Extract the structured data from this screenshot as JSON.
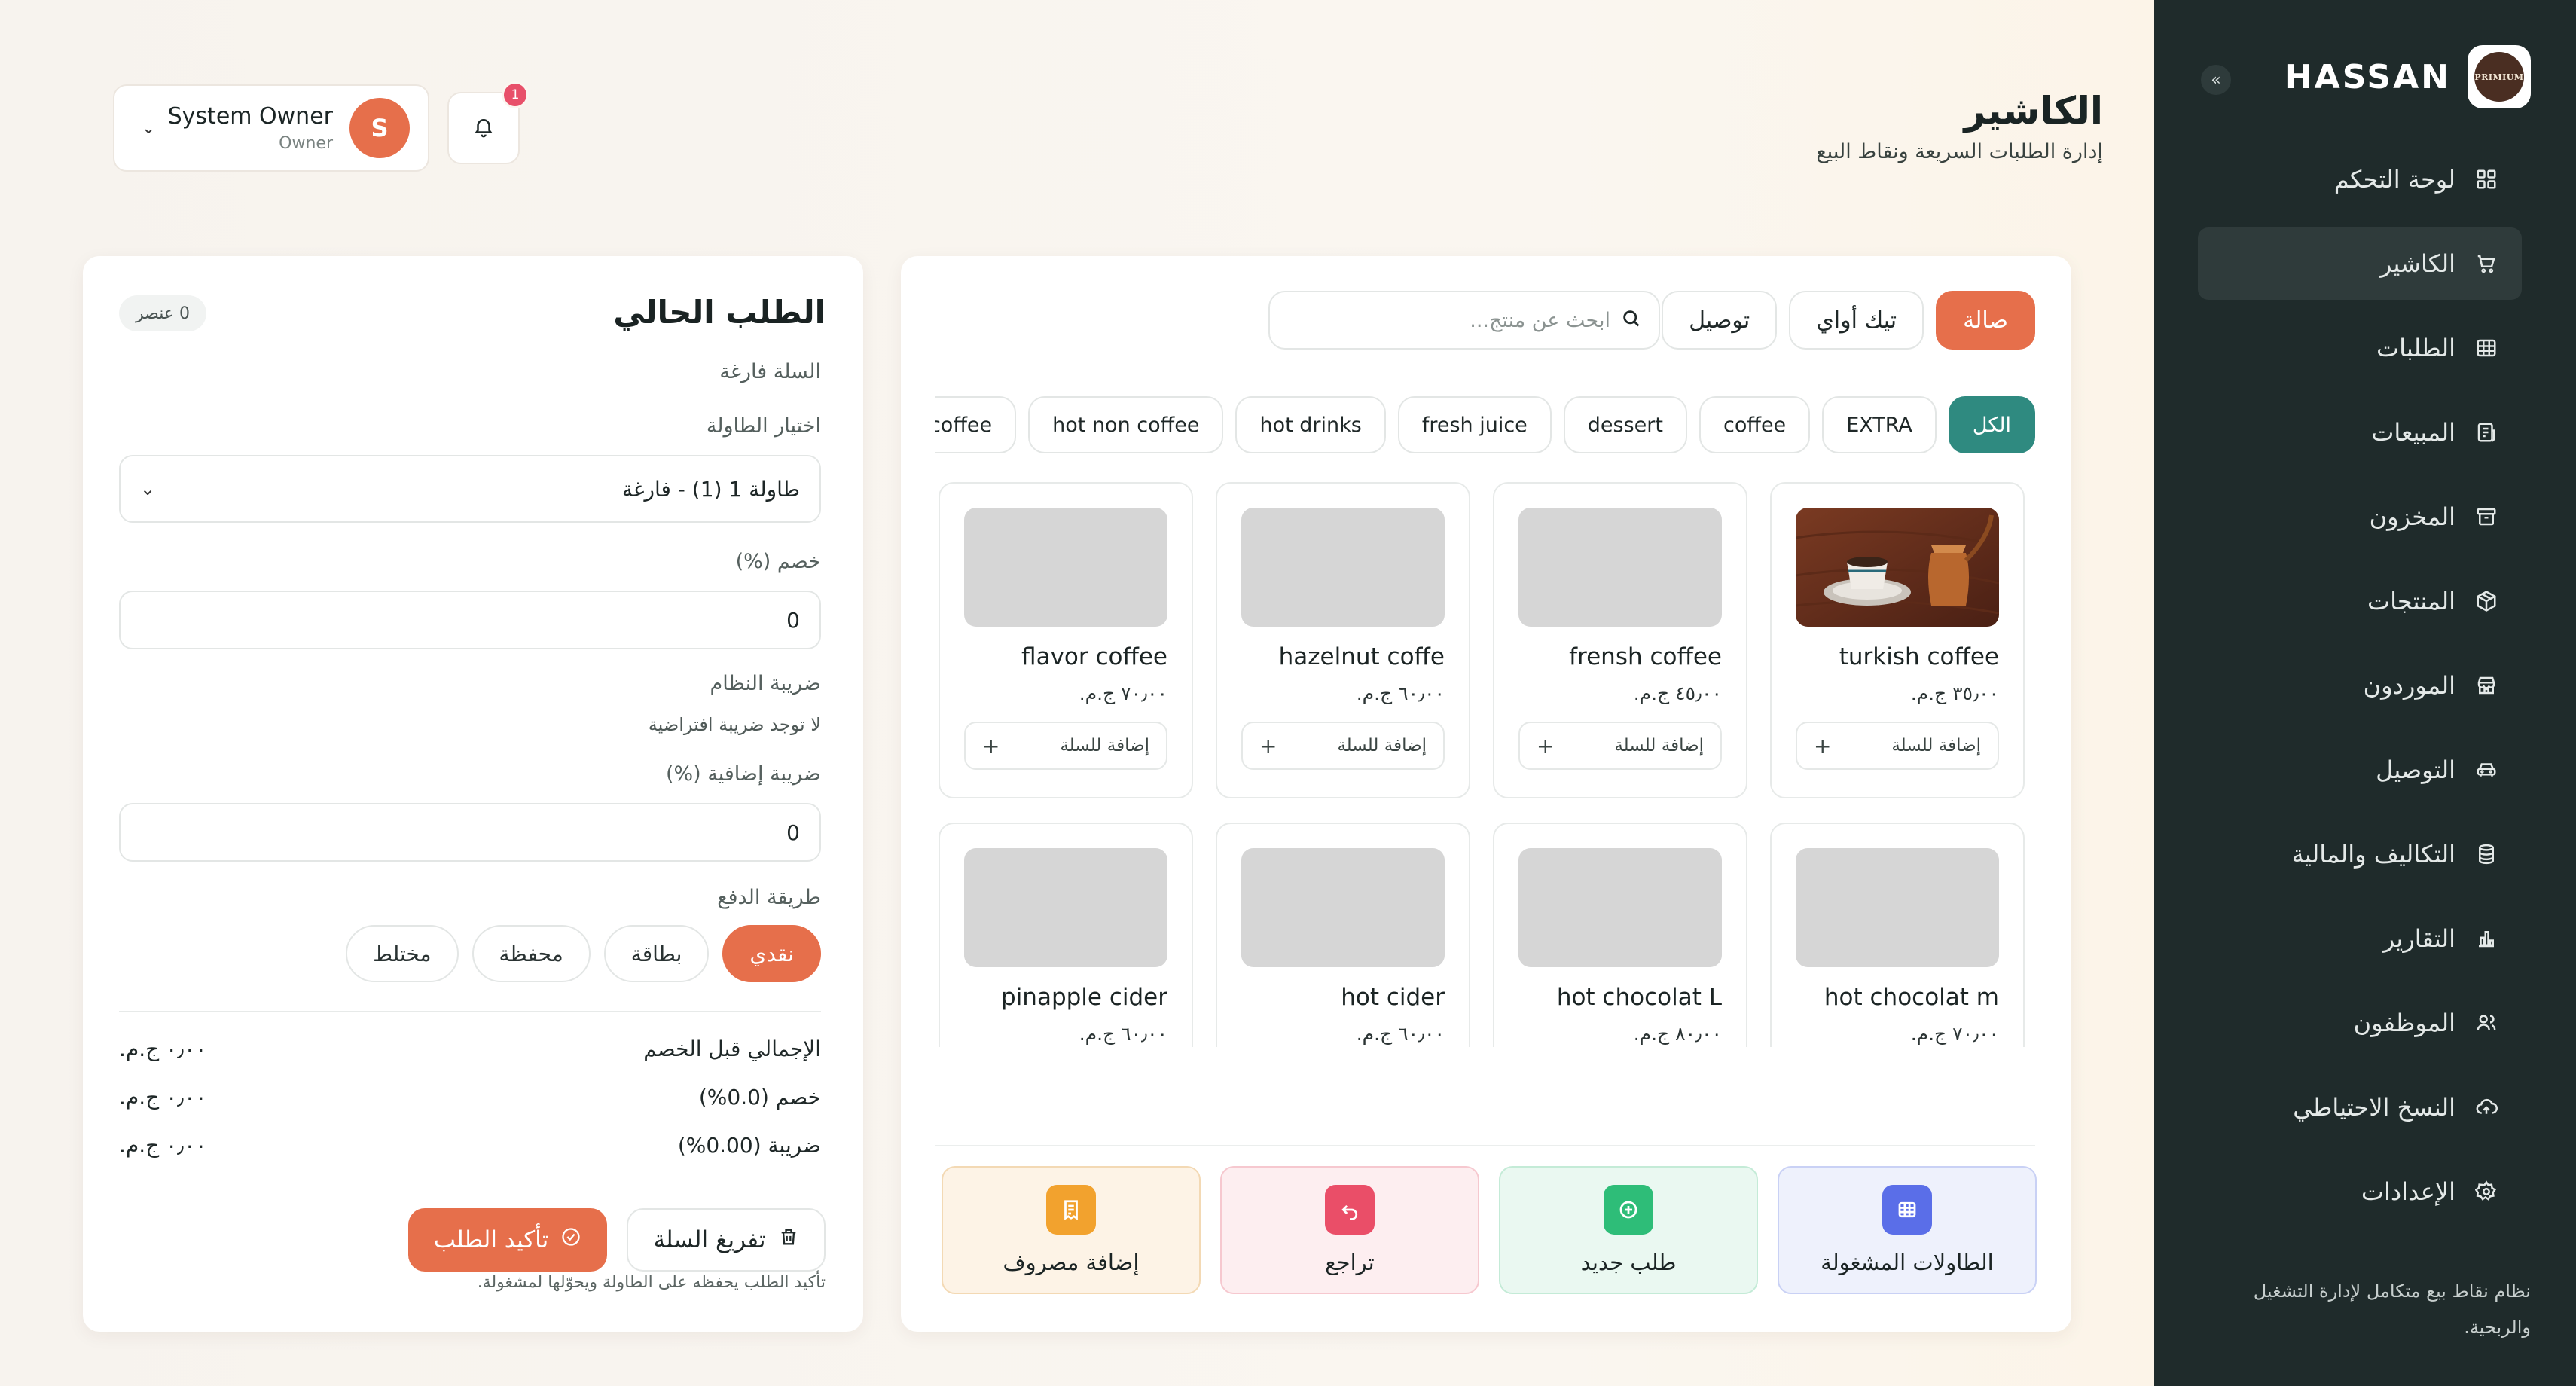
{
  "sidebar": {
    "brand": "HASSAN",
    "logo_text": "PRIMIUM",
    "collapse_icon": "«",
    "items": [
      {
        "label": "لوحة التحكم",
        "icon": "dashboard-icon"
      },
      {
        "label": "الكاشير",
        "icon": "cart-icon",
        "active": true
      },
      {
        "label": "الطلبات",
        "icon": "orders-icon"
      },
      {
        "label": "المبيعات",
        "icon": "sales-icon"
      },
      {
        "label": "المخزون",
        "icon": "archive-icon"
      },
      {
        "label": "المنتجات",
        "icon": "package-icon"
      },
      {
        "label": "الموردون",
        "icon": "store-icon"
      },
      {
        "label": "التوصيل",
        "icon": "car-icon"
      },
      {
        "label": "التكاليف والمالية",
        "icon": "database-icon"
      },
      {
        "label": "التقارير",
        "icon": "chart-icon"
      },
      {
        "label": "الموظفون",
        "icon": "users-icon"
      },
      {
        "label": "النسخ الاحتياطي",
        "icon": "cloud-upload-icon"
      },
      {
        "label": "الإعدادات",
        "icon": "gear-icon"
      }
    ],
    "description": "نظام نقاط بيع متكامل لإدارة التشغيل والربحية."
  },
  "header": {
    "title": "الكاشير",
    "subtitle": "إدارة الطلبات السريعة ونقاط البيع",
    "user": {
      "name": "System Owner",
      "role": "Owner",
      "initial": "S"
    },
    "notifications_count": "1"
  },
  "order": {
    "title": "الطلب الحالي",
    "items_badge": "0 عنصر",
    "empty_text": "السلة فارغة",
    "table_label": "اختيار الطاولة",
    "table_value": "طاولة 1 (1) - فارغة",
    "discount_label": "خصم (%)",
    "discount_value": "0",
    "system_tax_label": "ضريبة النظام",
    "system_tax_note": "لا توجد ضريبة افتراضية",
    "extra_tax_label": "ضريبة إضافية (%)",
    "extra_tax_value": "0",
    "payment_label": "طريقة الدفع",
    "payment_methods": [
      {
        "label": "نقدي",
        "active": true
      },
      {
        "label": "بطاقة",
        "active": false
      },
      {
        "label": "محفظة",
        "active": false
      },
      {
        "label": "مختلط",
        "active": false
      }
    ],
    "summary": [
      {
        "label": "الإجمالي قبل الخصم",
        "value": "٠٫٠٠ ج.م."
      },
      {
        "label": "خصم (0.0%)",
        "value": "٠٫٠٠ ج.م."
      },
      {
        "label": "ضريبة (0.00%)",
        "value": "٠٫٠٠ ج.م."
      }
    ],
    "confirm_label": "تأكيد الطلب",
    "clear_label": "تفريغ السلة",
    "confirm_hint": "تأكيد الطلب يحفظه على الطاولة ويحوّلها لمشغولة."
  },
  "products": {
    "order_types": [
      {
        "label": "صالة",
        "active": true
      },
      {
        "label": "تيك أواي",
        "active": false
      },
      {
        "label": "توصيل",
        "active": false
      }
    ],
    "search_placeholder": "ابحث عن منتج...",
    "categories": [
      {
        "label": "الكل",
        "active": true
      },
      {
        "label": "EXTRA"
      },
      {
        "label": "coffee"
      },
      {
        "label": "dessert"
      },
      {
        "label": "fresh juice"
      },
      {
        "label": "hot drinks"
      },
      {
        "label": "hot non coffee"
      },
      {
        "label": "non coffee"
      }
    ],
    "add_label": "إضافة للسلة",
    "items": [
      {
        "name": "turkish coffee",
        "price": "٣٥٫٠٠ ج.م.",
        "has_image": true
      },
      {
        "name": "frensh coffee",
        "price": "٤٥٫٠٠ ج.م."
      },
      {
        "name": "hazelnut coffe",
        "price": "٦٠٫٠٠ ج.م."
      },
      {
        "name": "flavor coffee",
        "price": "٧٠٫٠٠ ج.م."
      },
      {
        "name": "hot chocolat m",
        "price": "٧٠٫٠٠ ج.م."
      },
      {
        "name": "hot chocolat L",
        "price": "٨٠٫٠٠ ج.م."
      },
      {
        "name": "hot cider",
        "price": "٦٠٫٠٠ ج.م."
      },
      {
        "name": "pinapple cider",
        "price": "٦٠٫٠٠ ج.م."
      }
    ],
    "quick_actions": [
      {
        "label": "الطاولات المشغولة",
        "icon": "table-icon",
        "color": "#5a6ee8",
        "bg": "#eef1fc",
        "border": "#c9d1f5"
      },
      {
        "label": "طلب جديد",
        "icon": "plus-circle-icon",
        "color": "#2ebd78",
        "bg": "#eaf8f1",
        "border": "#c4ebd7"
      },
      {
        "label": "تراجع",
        "icon": "undo-icon",
        "color": "#ea4e68",
        "bg": "#fdeef0",
        "border": "#f6c8cf"
      },
      {
        "label": "إضافة مصروف",
        "icon": "receipt-icon",
        "color": "#f2a22e",
        "bg": "#fdf3e6",
        "border": "#f3d9b4"
      }
    ]
  }
}
